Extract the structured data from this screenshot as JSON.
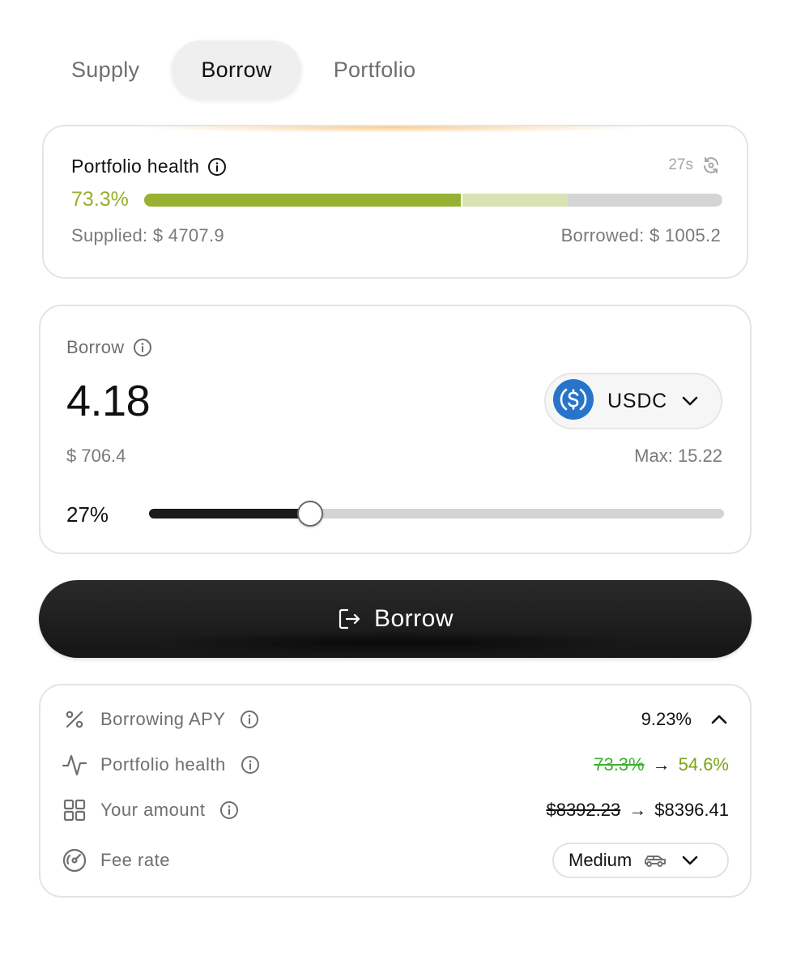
{
  "tabs": [
    {
      "label": "Supply",
      "active": false
    },
    {
      "label": "Borrow",
      "active": true
    },
    {
      "label": "Portfolio",
      "active": false
    }
  ],
  "health": {
    "title": "Portfolio health",
    "refresh_label": "27s",
    "percent_label": "73.3%",
    "current_fraction": 0.548,
    "previous_fraction": 0.733,
    "supplied_label": "Supplied: $ 4707.9",
    "borrowed_label": "Borrowed: $ 1005.2"
  },
  "borrow": {
    "label": "Borrow",
    "amount": "4.18",
    "token": "USDC",
    "token_icon": "usdc-coin-icon",
    "usd_value": "$ 706.4",
    "max_label": "Max: 15.22",
    "slider_label": "27%",
    "slider_fraction": 0.28
  },
  "button": {
    "label": "Borrow",
    "icon": "exit-arrow-icon"
  },
  "details": {
    "apy": {
      "label": "Borrowing APY",
      "value": "9.23%"
    },
    "health": {
      "label": "Portfolio health",
      "old": "73.3%",
      "new": "54.6%"
    },
    "amount": {
      "label": "Your amount",
      "old": "$8392.23",
      "new": "$8396.41"
    },
    "fee": {
      "label": "Fee rate",
      "value": "Medium"
    },
    "arrow": "→"
  },
  "colors": {
    "health_green": "#95b02c",
    "health_light": "#d8e3b3",
    "new_green": "#7aa416",
    "old_green": "#39b22a",
    "usdc_blue": "#2775ca"
  }
}
